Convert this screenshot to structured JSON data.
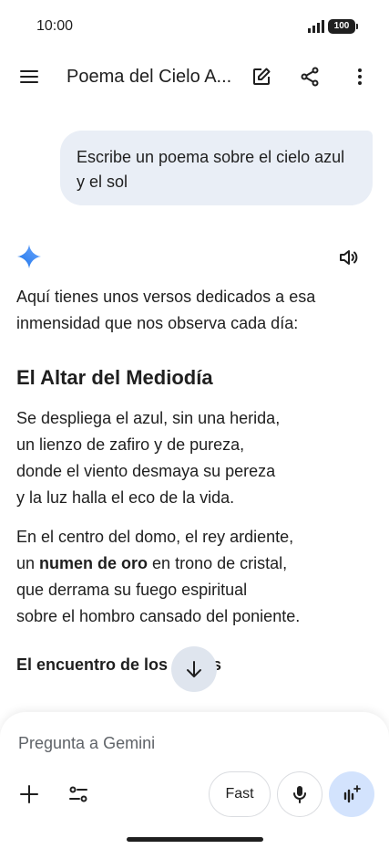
{
  "status_bar": {
    "time": "10:00",
    "battery": "100"
  },
  "top_bar": {
    "title": "Poema del Cielo A..."
  },
  "user_message": "Escribe un poema sobre el cielo azul y el sol",
  "response": {
    "intro": "Aquí tienes unos versos dedicados a esa inmensidad que nos observa cada día:",
    "heading": "El Altar del Mediodía",
    "stanza1": [
      "Se despliega el azul, sin una herida,",
      "un lienzo de zafiro y de pureza,",
      "donde el viento desmaya su pereza",
      "y la luz halla el eco de la vida."
    ],
    "stanza2": {
      "line1": "En el centro del domo, el rey ardiente,",
      "line2_pre": "un ",
      "line2_bold": "numen de oro",
      "line2_post": " en trono de cristal,",
      "line3": "que derrama su fuego espiritual",
      "line4": "sobre el hombro cansado del poniente."
    },
    "subheading": "El encuentro de los astros"
  },
  "input": {
    "placeholder": "Pregunta a Gemini",
    "fast_label": "Fast"
  },
  "colors": {
    "bubble": "#e9eef6",
    "gemini_blue": "#4285f4",
    "live_button": "#d3e3fd"
  },
  "icons": [
    "menu-icon",
    "edit-icon",
    "share-icon",
    "more-vert-icon",
    "gemini-sparkle-icon",
    "speaker-icon",
    "arrow-down-icon",
    "plus-icon",
    "tools-icon",
    "mic-icon",
    "live-icon"
  ]
}
